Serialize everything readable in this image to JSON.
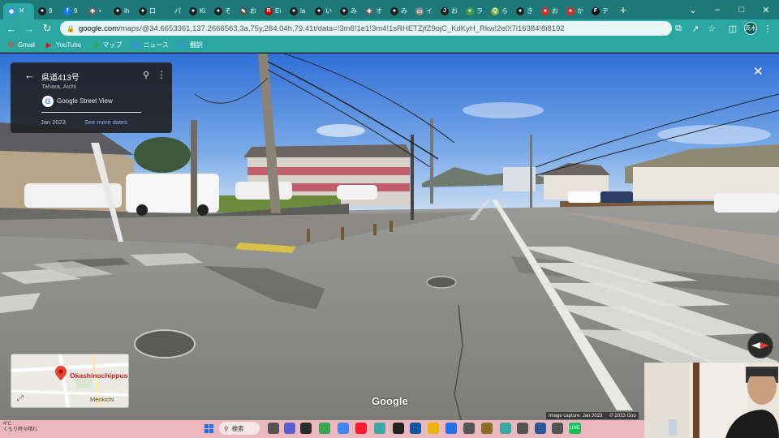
{
  "browser": {
    "tabs": [
      {
        "icon": "google-maps-icon",
        "label": "",
        "active": true
      },
      {
        "icon": "chrome-page-icon",
        "label": "9"
      },
      {
        "icon": "facebook-icon",
        "label": "9"
      },
      {
        "icon": "plugin-icon",
        "label": "•"
      },
      {
        "icon": "chrome-page-icon",
        "label": "ih"
      },
      {
        "icon": "chrome-page-icon",
        "label": "口"
      },
      {
        "icon": "blank-icon",
        "label": "パ"
      },
      {
        "icon": "chrome-page-icon",
        "label": "Ki"
      },
      {
        "icon": "chrome-page-icon",
        "label": "そ"
      },
      {
        "icon": "edit-icon",
        "label": "お"
      },
      {
        "icon": "rakuten-icon",
        "label": "Ei"
      },
      {
        "icon": "chrome-page-icon",
        "label": "ia"
      },
      {
        "icon": "chrome-page-icon",
        "label": "い"
      },
      {
        "icon": "chrome-page-icon",
        "label": "み"
      },
      {
        "icon": "plugin-icon",
        "label": "オ"
      },
      {
        "icon": "chrome-page-icon",
        "label": "み"
      },
      {
        "icon": "screen-icon",
        "label": "イ"
      },
      {
        "icon": "j-icon",
        "label": "お"
      },
      {
        "icon": "frog-icon",
        "label": "ラ"
      },
      {
        "icon": "q-icon",
        "label": "ら"
      },
      {
        "icon": "chrome-page-icon",
        "label": "き"
      },
      {
        "icon": "red-icon",
        "label": "お"
      },
      {
        "icon": "red-icon",
        "label": "か"
      },
      {
        "icon": "f-icon",
        "label": "テ"
      }
    ],
    "window_controls": {
      "minimize": "–",
      "maximize": "□",
      "close": "✕",
      "dropdown": "⌄"
    },
    "url_host": "google.com",
    "url_rest": "/maps/@34.6653361,137.2666563,3a,75y,284.04h,79.41t/data=!3m6!1e1!3m4!1sRHETZjfZ9ojC_KdKyH_Rkw!2e0!7i16384!8i8192",
    "profile_initial": "高木",
    "bookmarks": [
      {
        "icon": "gmail-icon",
        "label": "Gmail"
      },
      {
        "icon": "youtube-icon",
        "label": "YouTube"
      },
      {
        "icon": "maps-icon",
        "label": "マップ"
      },
      {
        "icon": "news-icon",
        "label": "ニュース"
      },
      {
        "icon": "translate-icon",
        "label": "翻訳"
      }
    ]
  },
  "streetview": {
    "title": "県道413号",
    "subtitle": "Tahara, Aichi",
    "provider": "Google Street View",
    "date": "Jan 2023",
    "more_dates": "See more dates",
    "google_logo": "Google",
    "capture_date": "Image capture: Jan 2023",
    "copyright": "© 2023 Goo"
  },
  "minimap": {
    "place": "Okashinochippuse",
    "place2": "Menkichi"
  },
  "taskbar": {
    "weather_temp": "4°C",
    "weather_desc": "くもり時々晴れ",
    "search_label": "検索"
  }
}
